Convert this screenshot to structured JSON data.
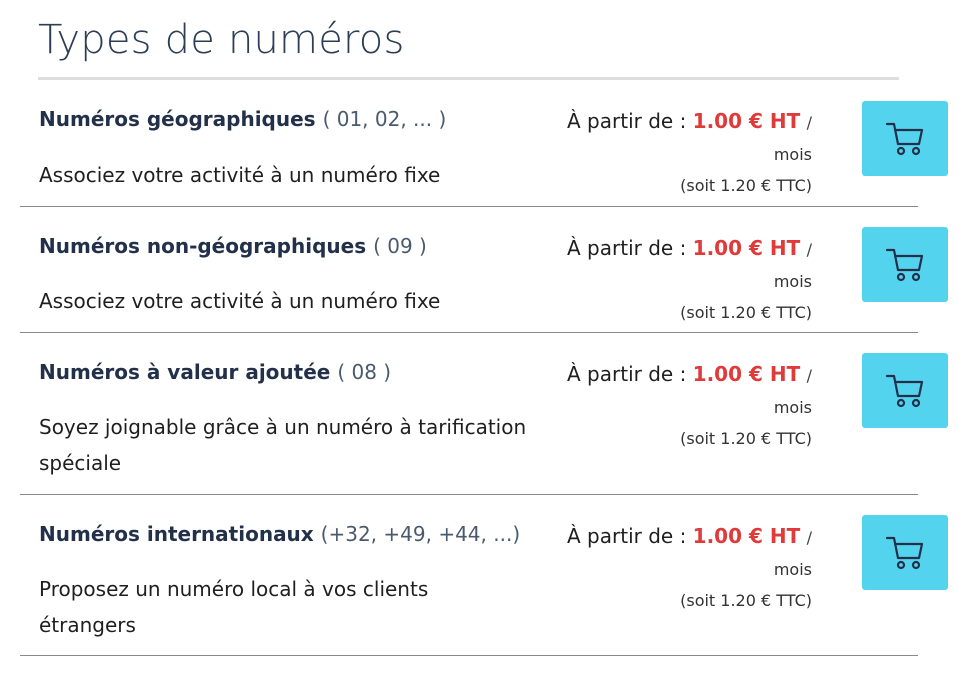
{
  "page": {
    "title": "Types de numéros"
  },
  "rows": [
    {
      "title": "Numéros géographiques",
      "codes": "( 01, 02, ... )",
      "description": "Associez votre activité à un numéro fixe",
      "price_prefix": "À partir de :",
      "price_amount": "1.00 € HT",
      "price_slash": "/",
      "price_period": "mois",
      "price_ttc": "(soit 1.20 € TTC)"
    },
    {
      "title": "Numéros non-géographiques",
      "codes": "( 09 )",
      "description": "Associez votre activité à un numéro fixe",
      "price_prefix": "À partir de :",
      "price_amount": "1.00 € HT",
      "price_slash": "/",
      "price_period": "mois",
      "price_ttc": "(soit 1.20 € TTC)"
    },
    {
      "title": "Numéros à valeur ajoutée",
      "codes": "( 08 )",
      "description": "Soyez joignable grâce à un numéro à tarification spéciale",
      "price_prefix": "À partir de :",
      "price_amount": "1.00 € HT",
      "price_slash": "/",
      "price_period": "mois",
      "price_ttc": "(soit 1.20 € TTC)"
    },
    {
      "title": "Numéros internationaux",
      "codes": "(+32, +49, +44, ...)",
      "description": "Proposez un numéro local à vos clients étrangers",
      "price_prefix": "À partir de :",
      "price_amount": "1.00 € HT",
      "price_slash": "/",
      "price_period": "mois",
      "price_ttc": "(soit 1.20 € TTC)"
    }
  ],
  "icons": {
    "cart": "shopping-cart-icon"
  },
  "colors": {
    "accent": "#54d3ee",
    "price": "#e03a3a",
    "title": "#22304a"
  }
}
